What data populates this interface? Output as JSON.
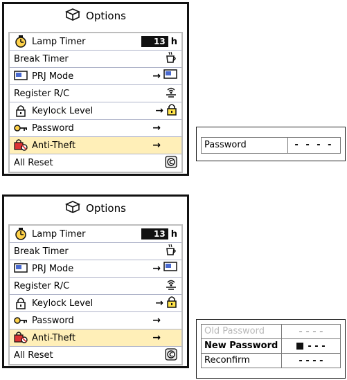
{
  "panel_top": {
    "title": "Options",
    "items": [
      {
        "label": "Lamp Timer",
        "icon": "lamp-timer-icon",
        "value": "13",
        "unit": "h"
      },
      {
        "label": "Break Timer",
        "icon": "",
        "right_icon": "cup-icon"
      },
      {
        "label": "PRJ Mode",
        "icon": "projector-mode-icon",
        "arrow": "→"
      },
      {
        "label": "Register R/C",
        "icon": "",
        "right_icon": "signal-icon"
      },
      {
        "label": "Keylock Level",
        "icon": "lock-icon",
        "arrow": "→"
      },
      {
        "label": "Password",
        "icon": "key-icon",
        "arrow": "→"
      },
      {
        "label": "Anti-Theft",
        "icon": "anti-theft-icon",
        "arrow": "→",
        "selected": true
      },
      {
        "label": "All Reset",
        "icon": "",
        "right_icon": "reset-icon"
      }
    ]
  },
  "panel_bottom": {
    "title": "Options",
    "items": [
      {
        "label": "Lamp Timer",
        "value": "13",
        "unit": "h"
      },
      {
        "label": "Break Timer"
      },
      {
        "label": "PRJ Mode",
        "arrow": "→"
      },
      {
        "label": "Register R/C"
      },
      {
        "label": "Keylock Level",
        "arrow": "→"
      },
      {
        "label": "Password",
        "arrow": "→"
      },
      {
        "label": "Anti-Theft",
        "arrow": "→",
        "selected": true
      },
      {
        "label": "All Reset"
      }
    ]
  },
  "password_box": {
    "label": "Password",
    "value": "- - - -"
  },
  "change_password": {
    "rows": [
      {
        "label": "Old Password",
        "value": "- - - -"
      },
      {
        "label": "New Password",
        "value": "- - -"
      },
      {
        "label": "Reconfirm",
        "value": "- - - -"
      }
    ]
  }
}
